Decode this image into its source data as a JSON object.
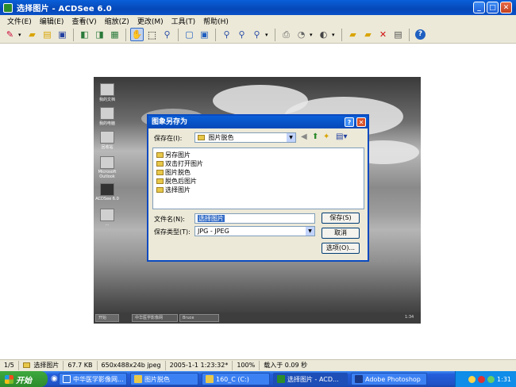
{
  "window": {
    "title": "选择图片 - ACDSee 6.0",
    "minimize_icon": "minimize-icon",
    "maximize_icon": "maximize-icon",
    "close_icon": "close-icon"
  },
  "menu": [
    "文件(E)",
    "编辑(E)",
    "查看(V)",
    "缩放(Z)",
    "更改(M)",
    "工具(T)",
    "帮助(H)"
  ],
  "toolbar": {
    "icons": [
      "browse-icon",
      "open-folder-icon",
      "open-file-icon",
      "save-icon",
      "prev-image-icon",
      "next-image-icon",
      "slideshow-icon",
      "hand-tool-icon",
      "select-tool-icon",
      "zoom-icon",
      "fit-window-icon",
      "full-screen-icon",
      "zoom-in-icon",
      "zoom-out-icon",
      "zoom-dropdown-icon",
      "print-icon",
      "acquire-icon",
      "rotate-icon",
      "batch-icon",
      "edit-icon",
      "delete-icon",
      "properties-icon",
      "help-icon"
    ],
    "active": "hand-tool-icon"
  },
  "desktop_icons": [
    "我的文档",
    "我的电脑",
    "回收站",
    "Microsoft Outlook",
    "ACDSee 6.0",
    "..."
  ],
  "inner_taskbar": {
    "start": "开始",
    "items": [
      "中华医学影像网",
      "Bruce"
    ],
    "clock": "1:34"
  },
  "dialog": {
    "title": "图象另存为",
    "save_in_label": "保存在(I):",
    "save_in_value": "图片脱色",
    "folders": [
      "另存图片",
      "双击打开图片",
      "图片脱色",
      "脱色后图片",
      "选择图片"
    ],
    "filename_label": "文件名(N):",
    "filename_value": "选择图片",
    "filetype_label": "保存类型(T):",
    "filetype_value": "JPG - JPEG",
    "save_button": "保存(S)",
    "cancel_button": "取消",
    "options_button": "选项(O)...",
    "help_icon": "?",
    "close_icon": "✕"
  },
  "status": {
    "index": "1/5",
    "name": "选择图片",
    "size": "67.7 KB",
    "dimensions": "650x488x24b jpeg",
    "date": "2005-1-1 1:23:32*",
    "zoom": "100%",
    "load_time": "载入于 0.09 秒"
  },
  "taskbar": {
    "start_label": "开始",
    "items": [
      "中华医学影像网...",
      "图片脱色",
      "160_C (C:)",
      "选择图片 - ACD...",
      "Adobe Photoshop"
    ],
    "active_index": 3,
    "clock": "1:31"
  }
}
